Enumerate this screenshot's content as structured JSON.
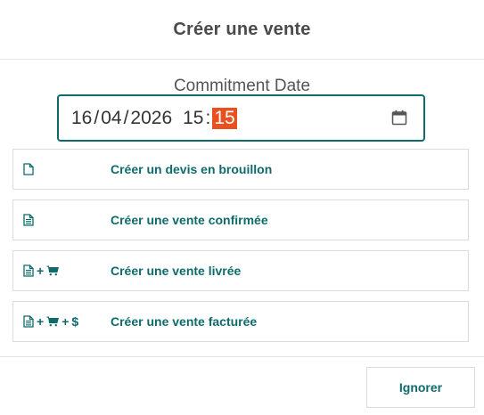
{
  "dialog": {
    "title": "Créer une vente"
  },
  "commitment": {
    "label": "Commitment Date",
    "day": "16",
    "month": "04",
    "year": "2026",
    "hour": "15",
    "minute": "15",
    "date_sep": "/",
    "time_sep": ":",
    "highlight_color": "#e8501f"
  },
  "actions": [
    {
      "label": "Créer un devis en brouillon",
      "icons": [
        "file-icon"
      ]
    },
    {
      "label": "Créer une vente confirmée",
      "icons": [
        "file-text-icon"
      ]
    },
    {
      "label": "Créer une vente livrée",
      "icons": [
        "file-text-icon",
        "+",
        "cart-icon"
      ]
    },
    {
      "label": "Créer une vente facturée",
      "icons": [
        "file-text-icon",
        "+",
        "cart-icon",
        "+",
        "$"
      ]
    }
  ],
  "footer": {
    "ignore_label": "Ignorer"
  },
  "colors": {
    "accent": "#0f6b6b",
    "title": "#4a4a4a",
    "border": "#dcdcdc"
  }
}
